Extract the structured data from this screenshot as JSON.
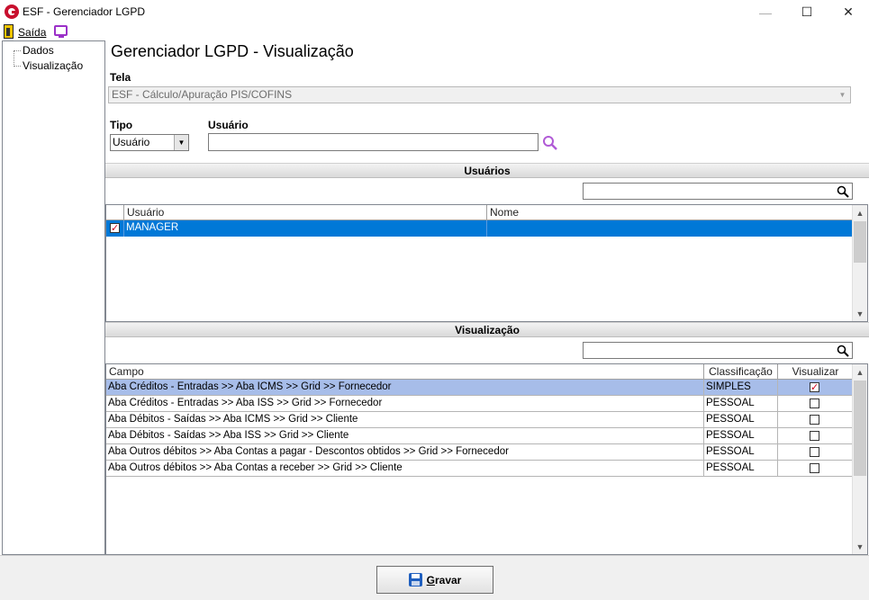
{
  "window": {
    "title": "ESF - Gerenciador LGPD",
    "min_glyph": "—",
    "max_glyph": "☐",
    "close_glyph": "✕"
  },
  "menu": {
    "saida": "Saída",
    "exit_icon": "door-exit-icon",
    "monitor_icon": "monitor-icon"
  },
  "tree": {
    "items": [
      "Dados",
      "Visualização"
    ]
  },
  "page": {
    "title": "Gerenciador LGPD - Visualização",
    "tela_label": "Tela",
    "tela_value": "ESF - Cálculo/Apuração PIS/COFINS",
    "tipo_label": "Tipo",
    "tipo_value": "Usuário",
    "usuario_label": "Usuário",
    "usuario_value": ""
  },
  "usuarios": {
    "section_title": "Usuários",
    "filter_value": "",
    "columns": [
      "Usuário",
      "Nome"
    ],
    "rows": [
      {
        "checked": true,
        "usuario": "MANAGER",
        "nome": ""
      }
    ]
  },
  "visualizacao": {
    "section_title": "Visualização",
    "filter_value": "",
    "columns": [
      "Campo",
      "Classificação",
      "Visualizar"
    ],
    "rows": [
      {
        "campo": "Aba Créditos - Entradas >> Aba ICMS >> Grid >> Fornecedor",
        "classificacao": "SIMPLES",
        "visualizar": true
      },
      {
        "campo": "Aba Créditos - Entradas >> Aba ISS >> Grid >> Fornecedor",
        "classificacao": "PESSOAL",
        "visualizar": false
      },
      {
        "campo": "Aba Débitos - Saídas >> Aba ICMS >> Grid >> Cliente",
        "classificacao": "PESSOAL",
        "visualizar": false
      },
      {
        "campo": "Aba Débitos - Saídas >> Aba ISS >> Grid >> Cliente",
        "classificacao": "PESSOAL",
        "visualizar": false
      },
      {
        "campo": "Aba Outros débitos >> Aba Contas a pagar - Descontos obtidos >> Grid >> Fornecedor",
        "classificacao": "PESSOAL",
        "visualizar": false
      },
      {
        "campo": "Aba Outros débitos >> Aba Contas a receber >> Grid >> Cliente",
        "classificacao": "PESSOAL",
        "visualizar": false
      }
    ]
  },
  "footer": {
    "gravar_label": "Gravar",
    "gravar_icon": "save-disk-icon"
  },
  "colors": {
    "selected_row": "#0078d7",
    "highlight_row": "#a7bde9",
    "accent_purple": "#9b30c8",
    "brand_red": "#c8102e"
  }
}
